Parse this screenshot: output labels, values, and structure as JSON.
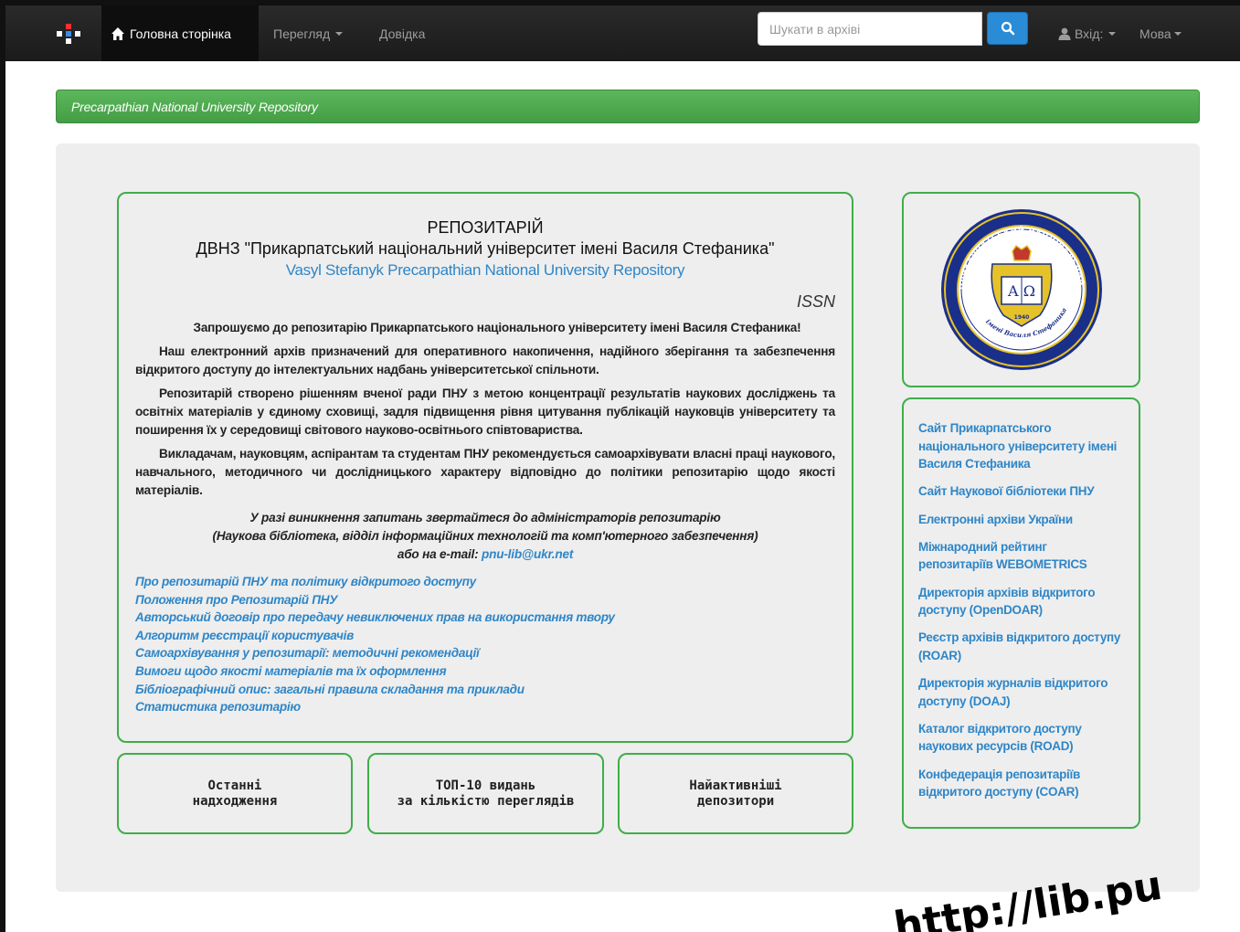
{
  "navbar": {
    "home_label": "Головна сторінка",
    "browse_label": "Перегляд",
    "help_label": "Довідка",
    "search_placeholder": "Шукати в архіві",
    "login_label": "Вхід:",
    "language_label": "Мова"
  },
  "banner": {
    "text": "Precarpathian National University Repository"
  },
  "main": {
    "title": "РЕПОЗИТАРІЙ",
    "subtitle": "ДВНЗ \"Прикарпатський національний університет імені Василя Стефаника\"",
    "english_title": "Vasyl Stefanyk Precarpathian National University Repository",
    "issn": "ISSN",
    "paragraphs": [
      "Запрошуємо до репозитарію Прикарпатського національного університету імені Василя Стефаника!",
      "Наш електронний архів призначений для оперативного накопичення, надійного зберігання та забезпечення відкритого доступу до інтелектуальних надбань університетської спільноти.",
      "Репозитарій створено рішенням вченої ради ПНУ з метою концентрації результатів наукових досліджень та освітніх матеріалів у єдиному сховищі, задля підвищення рівня цитування публікацій науковців університету та поширення їх у середовищі світового науково-освітнього співтовариства.",
      "Викладачам, науковцям, аспірантам та студентам ПНУ рекомендується самоархівувати власні праці наукового, навчального, методичного чи дослідницького характеру відповідно до політики репозитарію щодо якості матеріалів."
    ],
    "contact_line1": "У разі виникнення запитань звертайтеся до адміністраторів репозитарію",
    "contact_line2": "(Наукова бібліотека, відділ інформаційних технологій та комп'ютерного забезпечення)",
    "contact_prefix": "або на e-mail:",
    "contact_email": "pnu-lib@ukr.net",
    "links": [
      "Про репозитарій ПНУ та політику відкритого доступу",
      "Положення про Репозитарій ПНУ",
      "Авторський договір про передачу невиключених прав на використання твору",
      "Алгоритм реєстрації користувачів",
      "Самоархівування у репозитарії: методичні рекомендації",
      "Вимоги щодо якості матеріалів та їх оформлення",
      "Бібліографічний опис: загальні правила складання та приклади",
      "Статистика репозитарію"
    ]
  },
  "cards": [
    {
      "line1": "Останні",
      "line2": "надходження"
    },
    {
      "line1": "ТОП-10 видань",
      "line2": "за кількістю переглядів"
    },
    {
      "line1": "Найактивніші",
      "line2": "депозитори"
    }
  ],
  "resources": [
    "Сайт Прикарпатського національного університету імені Василя Стефаника",
    "Сайт Наукової бібліотеки ПНУ",
    "Електронні архіви України",
    "Міжнародний рейтинг репозитаріїв WEBOMETRICS",
    "Директорія архівів відкритого доступу (OpenDOAR)",
    "Реєстр архівів відкритого доступу (ROAR)",
    "Директорія журналів відкритого доступу (DOAJ)",
    "Каталог відкритого доступу наукових ресурсів (ROAD)",
    "Конфедерація репозитаріїв відкритого доступу (COAR)"
  ],
  "seal": {
    "ring_text": "ПРИКАРПАТСЬКИЙ НАЦІОНАЛЬНИЙ УНІВЕРСИТЕТ",
    "bottom_text": "імені Василя Стефаника",
    "letters": "A Ω",
    "year": "1940"
  },
  "stamp": {
    "text": "http://lib.pu"
  },
  "colors": {
    "navbar": "#1b1b1b",
    "banner": "#5cb85c",
    "box_border": "#3fae49",
    "link": "#2e86c8",
    "jumbotron": "#eeeeee"
  }
}
